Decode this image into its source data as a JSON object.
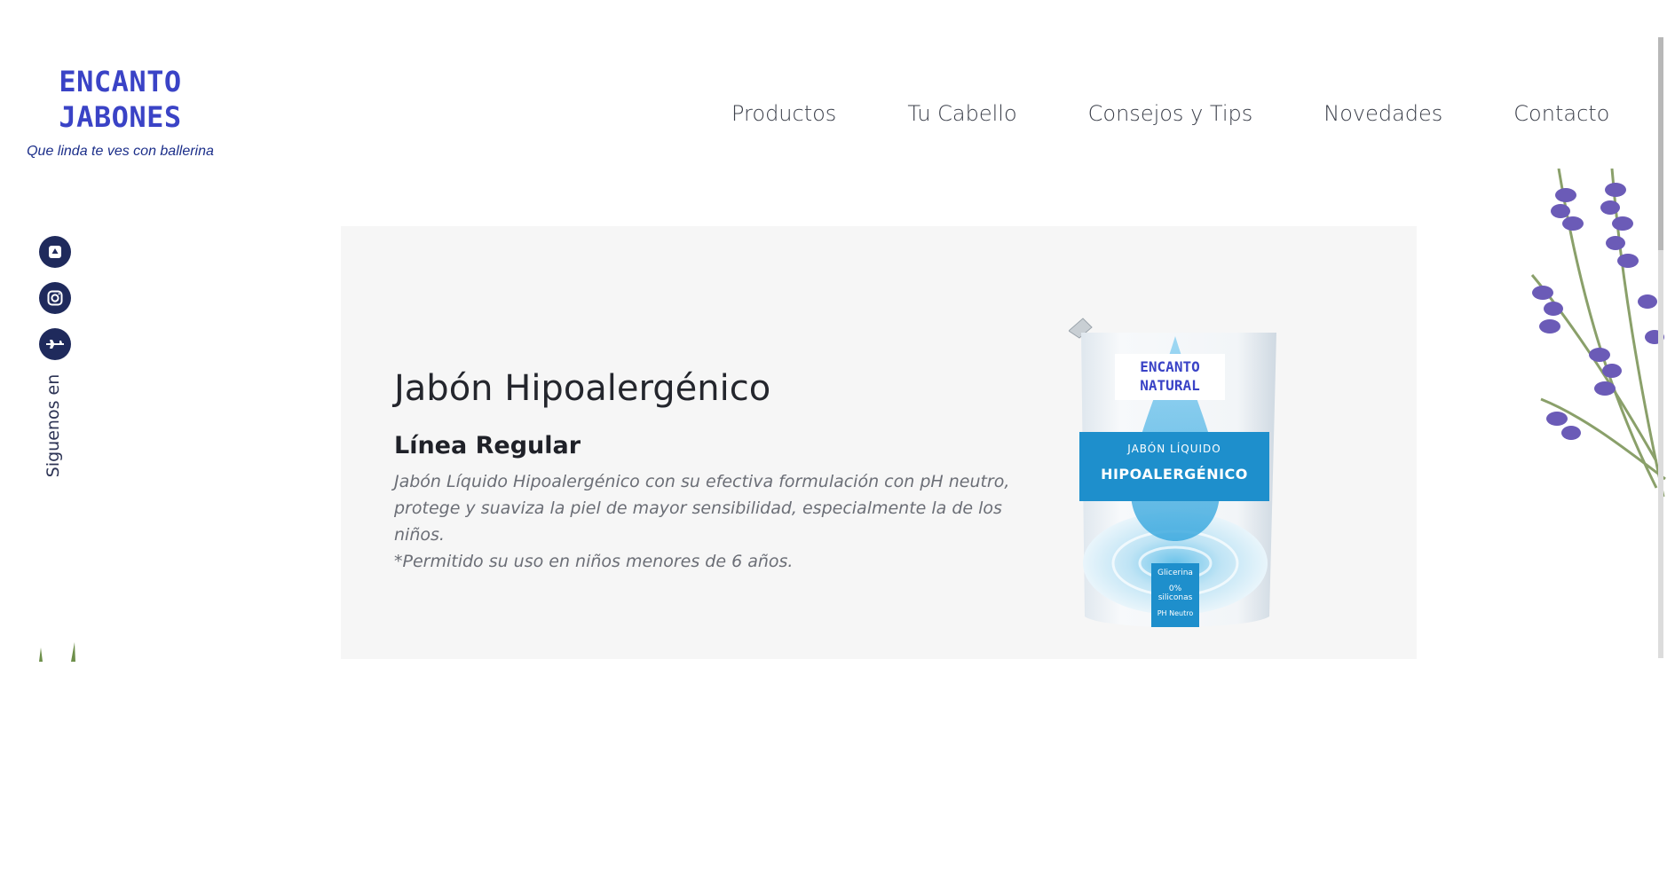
{
  "brand": {
    "line1": "ENCANTO",
    "line2": "JABONES",
    "tagline": "Que linda te ves con ballerina"
  },
  "nav": {
    "items": [
      {
        "label": "Productos"
      },
      {
        "label": "Tu Cabello"
      },
      {
        "label": "Consejos y Tips"
      },
      {
        "label": "Novedades"
      },
      {
        "label": "Contacto"
      }
    ]
  },
  "social": {
    "follow_label": "Siguenos en",
    "icons": [
      "app-icon",
      "instagram-icon",
      "plane-icon"
    ]
  },
  "product": {
    "title": "Jabón Hipoalergénico",
    "line": "Línea Regular",
    "description": [
      "Jabón Líquido Hipoalergénico con su efectiva formulación con pH neutro,",
      "protege y suaviza la piel de mayor sensibilidad, especialmente la de los niños.",
      "*Permitido su uso en niños menores de 6 años."
    ],
    "pouch": {
      "brand_line1": "ENCANTO",
      "brand_line2": "NATURAL",
      "band_sub": "JABÓN LÍQUIDO",
      "band_main": "HIPOALERGÉNICO",
      "tag_line1": "Glicerina",
      "tag_line2": "0% siliconas",
      "tag_line3": "PH Neutro"
    }
  },
  "colors": {
    "brand_blue": "#3a43c6",
    "tagline_blue": "#1c2f8a",
    "social_navy": "#1f2a5c",
    "card_bg": "#f6f6f6",
    "pouch_blue": "#1e8fcc",
    "lavender": "#6b5bb7"
  }
}
